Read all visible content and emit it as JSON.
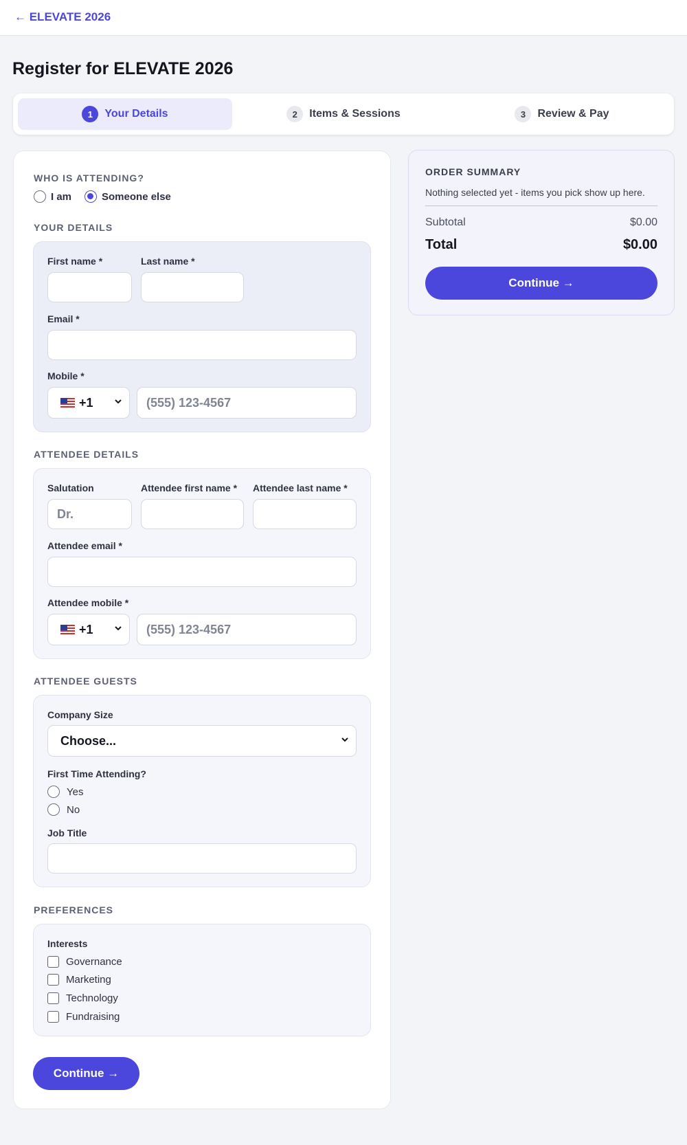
{
  "header": {
    "back_link": "← ELEVATE 2026"
  },
  "page_title": "Register for ELEVATE 2026",
  "steps": [
    {
      "num": "1",
      "label": "Your Details"
    },
    {
      "num": "2",
      "label": "Items & Sessions"
    },
    {
      "num": "3",
      "label": "Review & Pay"
    }
  ],
  "attending": {
    "title": "WHO IS ATTENDING?",
    "options": [
      "I am",
      "Someone else"
    ],
    "selected": "Someone else"
  },
  "your_details": {
    "title": "YOUR DETAILS",
    "first_name_label": "First name *",
    "last_name_label": "Last name *",
    "email_label": "Email *",
    "mobile_label": "Mobile *",
    "country_code": "+1",
    "phone_placeholder": "(555) 123-4567"
  },
  "attendee_details": {
    "title": "ATTENDEE DETAILS",
    "salutation_label": "Salutation",
    "salutation_placeholder": "Dr.",
    "first_name_label": "Attendee first name *",
    "last_name_label": "Attendee last name *",
    "email_label": "Attendee email *",
    "mobile_label": "Attendee mobile *",
    "country_code": "+1",
    "phone_placeholder": "(555) 123-4567"
  },
  "attendee_guests": {
    "title": "ATTENDEE GUESTS",
    "company_size_label": "Company Size",
    "company_size_value": "Choose...",
    "first_time_label": "First Time Attending?",
    "first_time_options": [
      "Yes",
      "No"
    ],
    "job_title_label": "Job Title"
  },
  "preferences": {
    "title": "PREFERENCES",
    "interests_label": "Interests",
    "interests": [
      "Governance",
      "Marketing",
      "Technology",
      "Fundraising"
    ]
  },
  "continue_label": "Continue →",
  "order_summary": {
    "title": "ORDER SUMMARY",
    "empty_text": "Nothing selected yet - items you pick show up here.",
    "subtotal_label": "Subtotal",
    "subtotal_value": "$0.00",
    "total_label": "Total",
    "total_value": "$0.00",
    "continue_label": "Continue →"
  },
  "colors": {
    "accent": "#4b46dc",
    "background": "#f3f4f8"
  }
}
